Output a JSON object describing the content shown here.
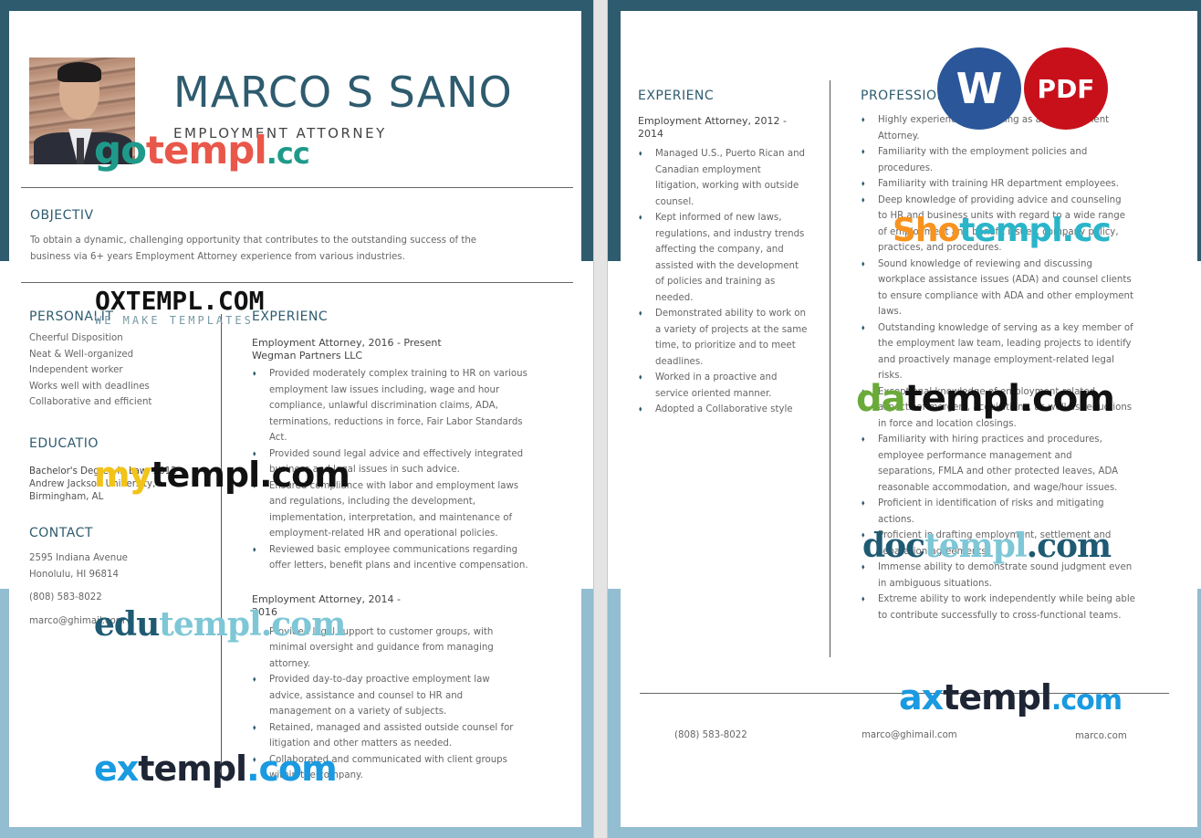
{
  "colors": {
    "accent": "#2e5b6e",
    "bottom_band": "#93bdd0",
    "word_badge": "#2b579a",
    "pdf_badge": "#c8101b"
  },
  "left_page": {
    "name": "MARCO S SANO",
    "role": "EMPLOYMENT ATTORNEY",
    "objective": {
      "heading": "OBJECTIV",
      "lines": [
        "To obtain a dynamic, challenging opportunity that contributes to the outstanding success of the",
        "business via 6+ years Employment Attorney experience from various industries."
      ]
    },
    "personality": {
      "heading": "PERSONALIT",
      "items": [
        "Cheerful Disposition",
        "Neat & Well-organized",
        "Independent worker",
        "Works well with deadlines",
        "Collaborative and efficient"
      ]
    },
    "education": {
      "heading": "EDUCATIO",
      "degree": "Bachelor's Degree in Law, 2012",
      "school": "Andrew Jackson University,",
      "location": "Birmingham, AL"
    },
    "contact": {
      "heading": "CONTACT",
      "address1": "2595 Indiana Avenue",
      "address2": "Honolulu, HI 96814",
      "phone": "(808) 583-8022",
      "email": "marco@ghimail.com"
    },
    "experience": {
      "heading": "EXPERIENC",
      "jobs": [
        {
          "title": "Employment Attorney, 2016 - Present",
          "company": "Wegman Partners LLC",
          "bullets": [
            [
              "Provided moderately complex training to HR on various",
              "employment law issues including, wage and hour",
              "compliance, unlawful discrimination claims, ADA,",
              "terminations, reductions in force, Fair Labor Standards",
              "Act."
            ],
            [
              "Provided sound legal advice and effectively integrated",
              "business and legal issues in such advice."
            ],
            [
              "Ensured compliance with labor and employment laws",
              "and regulations, including the development,",
              "implementation, interpretation, and maintenance of",
              "employment-related HR and operational policies."
            ],
            [
              "Reviewed basic employee communications regarding",
              "offer letters, benefit plans and incentive compensation."
            ]
          ]
        },
        {
          "title_line1": "Employment Attorney, 2014 -",
          "title_line2": "2016",
          "bullets": [
            [
              "Provided legal support to customer groups, with",
              "minimal oversight and guidance from managing",
              "attorney."
            ],
            [
              "Provided day-to-day proactive employment law",
              "advice, assistance and counsel to HR and",
              "management on a variety of subjects."
            ],
            [
              "Retained, managed and assisted outside counsel for",
              "litigation and other matters as needed."
            ],
            [
              "Collaborated and communicated with client groups",
              "within the company."
            ]
          ]
        }
      ]
    }
  },
  "right_page": {
    "experience": {
      "heading": "EXPERIENC",
      "title_line1": "Employment Attorney, 2012 -",
      "title_line2": "2014",
      "bullets": [
        [
          "Managed U.S., Puerto Rican and",
          "Canadian employment",
          "litigation, working with outside",
          "counsel."
        ],
        [
          "Kept informed of new laws,",
          "regulations, and industry trends",
          "affecting the company, and",
          "assisted with the development",
          "of policies and training as",
          "needed."
        ],
        [
          "Demonstrated ability to work on",
          "a variety of projects at the same",
          "time, to prioritize and to meet",
          "deadlines."
        ],
        [
          "Worked in a proactive and",
          "service oriented manner."
        ],
        [
          "Adopted a Collaborative style"
        ]
      ]
    },
    "skills": {
      "heading": "PROFESSIONAL SKILLS",
      "bullets": [
        [
          "Highly experienced in working as an Employment",
          "Attorney."
        ],
        [
          "Familiarity with the employment policies and",
          "procedures."
        ],
        [
          "Familiarity with training HR department employees."
        ],
        [
          "Deep knowledge of providing advice and counseling",
          "to HR and business units with regard to a wide range",
          "of employment and benefit issues, company policy,",
          "practices, and procedures."
        ],
        [
          "Sound knowledge of reviewing and discussing",
          "workplace assistance issues (ADA) and counsel clients",
          "to ensure compliance with ADA and other employment",
          "laws."
        ],
        [
          "Outstanding knowledge of serving as a key member of",
          "the employment law team, leading projects to identify",
          "and proactively manage employment-related legal",
          "risks."
        ],
        [
          "Exceptional knowledge of employment-related",
          "aspects of mergers, acquisitions, as well as reductions",
          "in force and location closings."
        ],
        [
          "Familiarity with hiring practices and procedures,",
          "employee performance management and",
          "separations, FMLA and other protected leaves, ADA",
          "reasonable accommodation, and wage/hour issues."
        ],
        [
          "Proficient in identification of risks and mitigating",
          "actions."
        ],
        [
          "Proficient in drafting employment, settlement and",
          "separation agreements."
        ],
        [
          "Immense ability to demonstrate sound judgment even",
          "in ambiguous situations."
        ],
        [
          "Extreme ability to work independently while being able",
          "to contribute successfully to cross-functional teams."
        ]
      ]
    },
    "footer": {
      "phone": "(808) 583-8022",
      "email": "marco@ghimail.com",
      "website": "marco.com"
    }
  },
  "badges": {
    "word": "W",
    "pdf": "PDF"
  },
  "watermarks": {
    "gotempl": [
      "go",
      "templ",
      ".cc"
    ],
    "oxtempl": [
      "OXTEMPL.COM",
      "WE MAKE TEMPLATES"
    ],
    "mytempl": [
      "my",
      "templ.com"
    ],
    "edutempl": [
      "edu",
      "templ.com"
    ],
    "extempl": [
      "ex",
      "templ",
      ".com"
    ],
    "shotempl": [
      "Sho",
      "templ.cc"
    ],
    "datempl": [
      "da",
      "templ.com"
    ],
    "doctempl": [
      "doc",
      "templ",
      ".com"
    ],
    "axtempl": [
      "ax",
      "templ",
      ".com"
    ]
  }
}
